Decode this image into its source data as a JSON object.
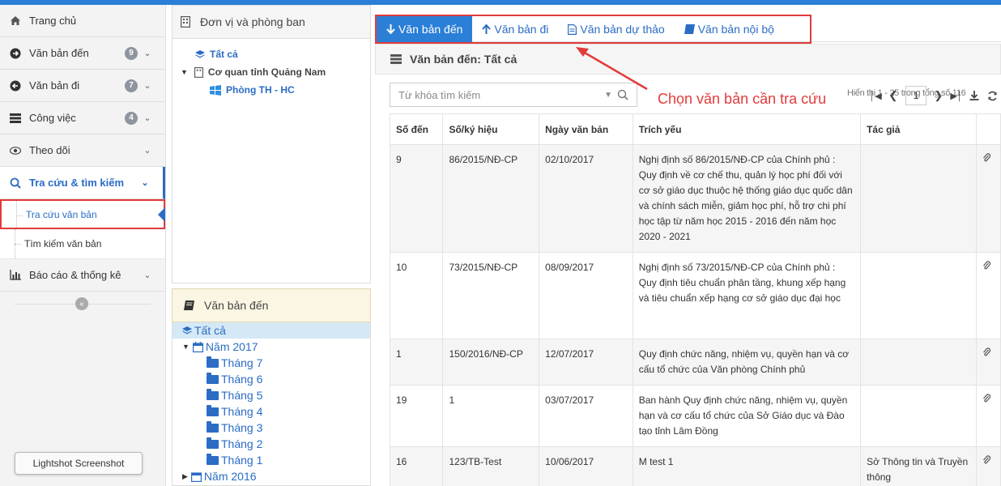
{
  "sidebar": {
    "items": [
      {
        "label": "Trang chủ",
        "icon": "home-icon"
      },
      {
        "label": "Văn bản đến",
        "icon": "arrow-right-circle-icon",
        "badge": "9"
      },
      {
        "label": "Văn bản đi",
        "icon": "arrow-left-circle-icon",
        "badge": "7"
      },
      {
        "label": "Công việc",
        "icon": "tasks-icon",
        "badge": "4"
      },
      {
        "label": "Theo dõi",
        "icon": "eye-icon"
      },
      {
        "label": "Tra cứu & tìm kiếm",
        "icon": "search-icon"
      }
    ],
    "sub_items": [
      "Tra cứu văn bản",
      "Tìm kiếm văn bản"
    ],
    "report": {
      "label": "Báo cáo & thống kê",
      "icon": "bar-chart-icon"
    },
    "tooltip": "Lightshot Screenshot"
  },
  "org_panel": {
    "title": "Đơn vị và phòng ban",
    "tree": [
      "Tất cả",
      "Cơ quan tỉnh Quảng Nam",
      "Phòng TH - HC"
    ]
  },
  "doc_panel": {
    "title": "Văn bản đến",
    "tree": [
      "Tất cả",
      "Năm 2017",
      "Tháng 7",
      "Tháng 6",
      "Tháng 5",
      "Tháng 4",
      "Tháng 3",
      "Tháng 2",
      "Tháng 1",
      "Năm 2016"
    ]
  },
  "tabs": [
    "Văn bản đến",
    "Văn bản đi",
    "Văn bản dự thảo",
    "Văn bản nội bộ"
  ],
  "content_title": "Văn bản đến: Tất cả",
  "search": {
    "placeholder": "Từ khóa tìm kiếm"
  },
  "paging": {
    "info": "Hiển thị 1 - 25 trong tổng số 116",
    "page": "1"
  },
  "annotation": "Chọn văn bản cần tra cứu",
  "table": {
    "headers": [
      "Số đến",
      "Số/ký hiệu",
      "Ngày văn bản",
      "Trích yếu",
      "Tác giả"
    ],
    "rows": [
      {
        "so_den": "9",
        "ky_hieu": "86/2015/NĐ-CP",
        "ngay": "02/10/2017",
        "trich_yeu": "Nghị định số 86/2015/NĐ-CP của Chính phủ : Quy định về cơ chế thu, quản lý học phí đối với cơ sở giáo dục thuộc hệ thống giáo dục quốc dân và chính sách miễn, giảm học phí, hỗ trợ chi phí học tập từ năm học 2015 - 2016 đến năm học 2020 - 2021",
        "tac_gia": ""
      },
      {
        "so_den": "10",
        "ky_hieu": "73/2015/NĐ-CP",
        "ngay": "08/09/2017",
        "trich_yeu": "Nghị định số 73/2015/NĐ-CP của Chính phủ : Quy định tiêu chuẩn phân tầng, khung xếp hạng và tiêu chuẩn xếp hạng cơ sở giáo dục đại học",
        "tac_gia": ""
      },
      {
        "so_den": "1",
        "ky_hieu": "150/2016/NĐ-CP",
        "ngay": "12/07/2017",
        "trich_yeu": "Quy định chức năng, nhiệm vụ, quyền hạn và cơ cấu tổ chức của Văn phòng Chính phủ",
        "tac_gia": ""
      },
      {
        "so_den": "19",
        "ky_hieu": "1",
        "ngay": "03/07/2017",
        "trich_yeu": "Ban hành Quy định chức năng, nhiệm vụ, quyền hạn và cơ cấu tổ chức của Sở Giáo dục và Đào tạo tỉnh Lâm Đồng",
        "tac_gia": ""
      },
      {
        "so_den": "16",
        "ky_hieu": "123/TB-Test",
        "ngay": "10/06/2017",
        "trich_yeu": "M test 1",
        "tac_gia": "Sở Thông tin và Truyền thông"
      }
    ]
  },
  "colors": {
    "accent": "#2b7fd6",
    "highlight_box": "#e23b3b",
    "badge": "#8e959f"
  }
}
